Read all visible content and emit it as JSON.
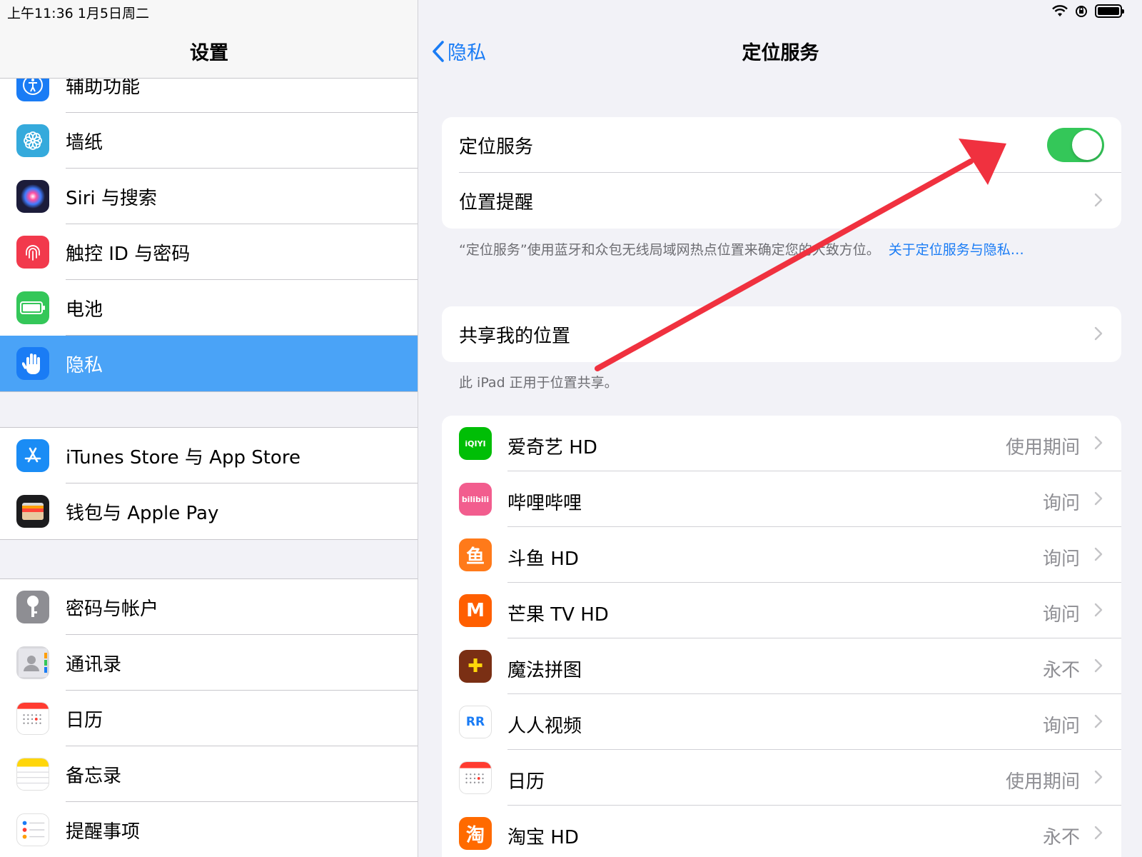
{
  "status_bar": {
    "time": "上午11:36   1月5日周二"
  },
  "left": {
    "title": "设置",
    "group1": [
      {
        "label": "辅助功能",
        "icon": "accessibility-icon",
        "color": "#1a7cf5"
      },
      {
        "label": "墙纸",
        "icon": "flower-icon",
        "color": "#35aadc"
      },
      {
        "label": "Siri 与搜索",
        "icon": "siri-icon",
        "color": "#1c1c3a"
      },
      {
        "label": "触控 ID 与密码",
        "icon": "fingerprint-icon",
        "color": "#f2394c"
      },
      {
        "label": "电池",
        "icon": "battery-icon",
        "color": "#34c759"
      },
      {
        "label": "隐私",
        "icon": "hand-icon",
        "color": "#1a7cf5"
      }
    ],
    "group2": [
      {
        "label": "iTunes Store 与 App Store",
        "icon": "app-store-icon",
        "color": "#1a8cf5"
      },
      {
        "label": "钱包与 Apple Pay",
        "icon": "wallet-icon",
        "color": "#1c1c1e"
      }
    ],
    "group3": [
      {
        "label": "密码与帐户",
        "icon": "key-icon",
        "color": "#8e8e93"
      },
      {
        "label": "通讯录",
        "icon": "contacts-icon",
        "color": "#d8d8dc"
      },
      {
        "label": "日历",
        "icon": "calendar-icon",
        "color": "#ffffff"
      },
      {
        "label": "备忘录",
        "icon": "notes-icon",
        "color": "#ffffff"
      },
      {
        "label": "提醒事项",
        "icon": "reminders-icon",
        "color": "#ffffff"
      }
    ]
  },
  "right": {
    "back_label": "隐私",
    "title": "定位服务",
    "location_services_label": "定位服务",
    "location_services_on": true,
    "location_alerts_label": "位置提醒",
    "footnote1": "“定位服务”使用蓝牙和众包无线局域网热点位置来确定您的大致方位。",
    "footnote1_link": "关于定位服务与隐私…",
    "share_location_label": "共享我的位置",
    "footnote2": "此 iPad 正用于位置共享。",
    "apps": [
      {
        "name": "爱奇艺 HD",
        "value": "使用期间",
        "icon": "iqiyi-icon",
        "color": "#00be06",
        "glyph": "iQIYI"
      },
      {
        "name": "哔哩哔哩",
        "value": "询问",
        "icon": "bilibili-icon",
        "color": "#f25d8e",
        "glyph": "bilibili"
      },
      {
        "name": "斗鱼 HD",
        "value": "询问",
        "icon": "douyu-icon",
        "color": "#ff7a1a",
        "glyph": "鱼"
      },
      {
        "name": "芒果 TV HD",
        "value": "询问",
        "icon": "mango-tv-icon",
        "color": "#ff5f00",
        "glyph": "M"
      },
      {
        "name": "魔法拼图",
        "value": "永不",
        "icon": "puzzle-icon",
        "color": "#7a2f14",
        "glyph": "✚"
      },
      {
        "name": "人人视频",
        "value": "询问",
        "icon": "renren-icon",
        "color": "#ffffff",
        "glyph": "RR"
      },
      {
        "name": "日历",
        "value": "使用期间",
        "icon": "calendar-icon",
        "color": "#ffffff",
        "glyph": ""
      },
      {
        "name": "淘宝 HD",
        "value": "永不",
        "icon": "taobao-icon",
        "color": "#ff6a00",
        "glyph": "淘"
      }
    ]
  },
  "colors": {
    "accent": "#1a7cf5",
    "toggle_on": "#34c759",
    "selected_row": "#4aa3f7",
    "annotation_arrow": "#f0313f"
  }
}
